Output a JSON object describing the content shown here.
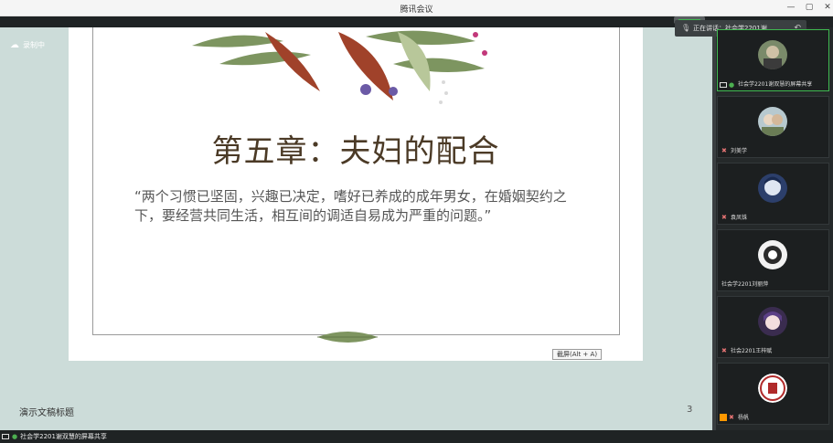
{
  "window": {
    "title": "腾讯会议",
    "controls": {
      "minimize": "—",
      "maximize": "▢",
      "close": "✕"
    }
  },
  "recording": {
    "label": "录制中",
    "icon": "cloud-icon"
  },
  "slide": {
    "title": "第五章：夫妇的配合",
    "quote": "“两个习惯已坚固，兴趣已决定，嗜好已养成的成年男女，在婚姻契约之下，要经营共同生活，相互间的调适自易成为严重的问题。”",
    "shortcut_tip": "截屏(Alt + A)"
  },
  "stage_footer": {
    "deck_title": "演示文稿标题",
    "page": "3"
  },
  "speaking": {
    "prefix": "正在讲话：",
    "name": "社会学2201谢..."
  },
  "participants": [
    {
      "name": "社会学2201谢双慧的屏幕共享",
      "status": "sharing"
    },
    {
      "name": "刘美学",
      "status": "muted"
    },
    {
      "name": "袁凤铢",
      "status": "muted"
    },
    {
      "name": "社会学2201刘丽萍",
      "status": "none"
    },
    {
      "name": "社会2201王梓赋",
      "status": "muted"
    },
    {
      "name": "杨帆",
      "status": "host"
    }
  ],
  "bottom_share": {
    "label": "社会学2201谢双慧的屏幕共享"
  },
  "colors": {
    "stage_bg": "#ccdcd9",
    "panel_bg": "#25292a",
    "accent_green": "#3fb950",
    "title_brown": "#4b3a26"
  }
}
